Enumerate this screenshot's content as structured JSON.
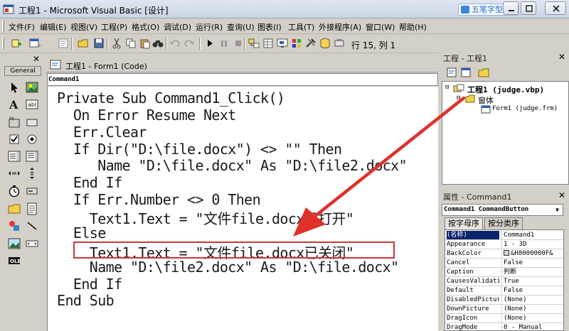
{
  "window": {
    "title": "工程1 - Microsoft Visual Basic [设计]",
    "watermark": "五笔字型"
  },
  "menu": [
    "文件(F)",
    "编辑(E)",
    "视图(V)",
    "工程(P)",
    "格式(O)",
    "调试(D)",
    "运行(R)",
    "查询(U)",
    "图表(I)",
    "工具(T)",
    "外接程序(A)",
    "窗口(W)",
    "帮助(H)"
  ],
  "toolbar": {
    "position": "行 15, 列 1"
  },
  "toolbox": {
    "title": "General"
  },
  "code_window": {
    "title": "工程1 - Form1 (Code)",
    "object": "Command1",
    "lines": [
      "Private Sub Command1_Click()",
      "  On Error Resume Next",
      "  Err.Clear",
      "  If Dir(\"D:\\file.docx\") <> \"\" Then",
      "     Name \"D:\\file.docx\" As \"D:\\file2.docx\"",
      "  End If",
      "  If Err.Number <> 0 Then",
      "    Text1.Text = \"文件file.docx已打开\"",
      "  Else",
      "    Text1.Text = \"文件file.docx已关闭\"",
      "    Name \"D:\\file2.docx\" As \"D:\\file.docx\"",
      "  End If",
      "End Sub"
    ]
  },
  "project_panel": {
    "title": "工程 - 工程1",
    "root": "工程1 (judge.vbp)",
    "folder": "窗体",
    "form": "Form1 (judge.frm)"
  },
  "properties_panel": {
    "title": "属性 - Command1",
    "object": "Command1 CommandButton",
    "tabs": [
      "按字母序",
      "按分类序"
    ],
    "rows": [
      {
        "name": "(名称)",
        "value": "Command1"
      },
      {
        "name": "Appearance",
        "value": "1 - 3D"
      },
      {
        "name": "BackColor",
        "value": "&H8000000F&"
      },
      {
        "name": "Cancel",
        "value": "False"
      },
      {
        "name": "Caption",
        "value": "判断"
      },
      {
        "name": "CausesValidati",
        "value": "True"
      },
      {
        "name": "Default",
        "value": "False"
      },
      {
        "name": "DisabledPictur",
        "value": "(None)"
      },
      {
        "name": "DownPicture",
        "value": "(None)"
      },
      {
        "name": "DragIcon",
        "value": "(None)"
      },
      {
        "name": "DragMode",
        "value": "0 - Manual"
      }
    ]
  },
  "colors": {
    "highlight_box": "#d0343a",
    "arrow": "#e0302c",
    "selection": "#0a246a"
  }
}
